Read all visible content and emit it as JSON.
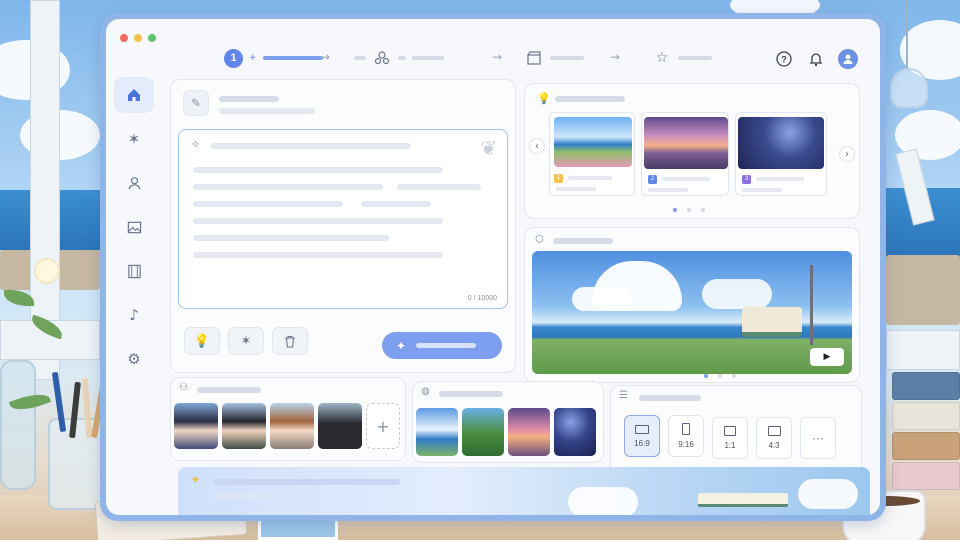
{
  "window": {
    "controls": [
      "close",
      "minimize",
      "maximize"
    ]
  },
  "stepper": {
    "steps": [
      {
        "number": "1",
        "icon": "pencil-spark-icon",
        "active": true
      },
      {
        "icon": "character-group-icon",
        "active": false
      },
      {
        "icon": "clapperboard-icon",
        "active": false
      },
      {
        "icon": "star-outline-icon",
        "active": false
      }
    ]
  },
  "topbar": {
    "help_icon": "?",
    "bell_icon": "bell-icon",
    "avatar_icon": "user-icon"
  },
  "sidebar": {
    "items": [
      {
        "icon": "home-icon",
        "active": true
      },
      {
        "icon": "sparkle-icon",
        "active": false
      },
      {
        "icon": "character-icon",
        "active": false
      },
      {
        "icon": "image-icon",
        "active": false
      },
      {
        "icon": "film-icon",
        "active": false
      },
      {
        "icon": "music-note-icon",
        "active": false
      },
      {
        "icon": "settings-icon",
        "active": false
      }
    ]
  },
  "editor": {
    "counter": "0 / 10000",
    "buttons": [
      "lightbulb-icon",
      "sparkle-icon",
      "trash-icon"
    ],
    "generate_icon": "✦"
  },
  "ideas": {
    "thumbnails": [
      {
        "badge": "1",
        "badge_color": "#f2c14e"
      },
      {
        "badge": "2",
        "badge_color": "#5f86e8"
      },
      {
        "badge": "3",
        "badge_color": "#8b6fe0"
      }
    ],
    "pagination": 3
  },
  "aspect_ratios": {
    "options": [
      "16:9",
      "9:16",
      "1:1",
      "4:3"
    ],
    "selected": "16:9",
    "more": "···"
  },
  "add_character": "+",
  "colors": {
    "accent": "#5f86e8",
    "monitor_bezel": "#8fb5e8",
    "generate_button": "#7e9ff0"
  }
}
